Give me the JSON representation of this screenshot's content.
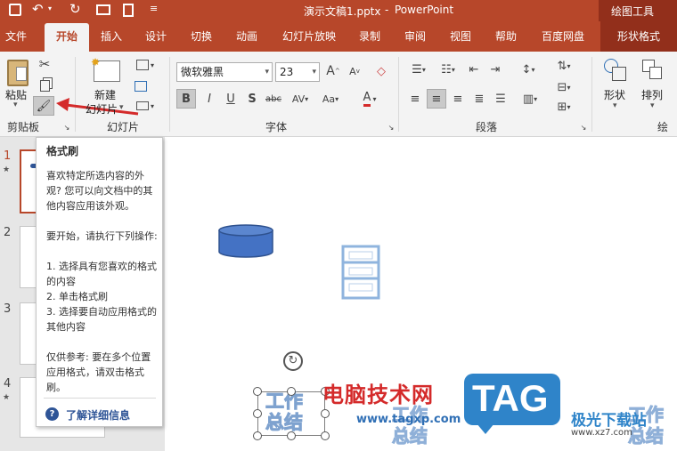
{
  "titlebar": {
    "doc_title": "演示文稿1.pptx",
    "app_name": "PowerPoint",
    "context_tab": "绘图工具",
    "colors": {
      "accent": "#b7472a",
      "accent_dark": "#922f1b"
    }
  },
  "tabs": [
    {
      "label": "文件"
    },
    {
      "label": "开始",
      "active": true
    },
    {
      "label": "插入"
    },
    {
      "label": "设计"
    },
    {
      "label": "切换"
    },
    {
      "label": "动画"
    },
    {
      "label": "幻灯片放映"
    },
    {
      "label": "录制"
    },
    {
      "label": "审阅"
    },
    {
      "label": "视图"
    },
    {
      "label": "帮助"
    },
    {
      "label": "百度网盘"
    },
    {
      "label": "形状格式"
    }
  ],
  "ribbon": {
    "clipboard": {
      "group_label": "剪贴板",
      "paste_label": "粘贴"
    },
    "slides": {
      "group_label": "幻灯片",
      "new_slide_label": "新建",
      "new_slide_label2": "幻灯片"
    },
    "font": {
      "group_label": "字体",
      "font_name": "微软雅黑",
      "font_size": "23"
    },
    "paragraph": {
      "group_label": "段落"
    },
    "drawing": {
      "group_label": "绘图",
      "shapes_label": "形状",
      "arrange_label": "排列"
    }
  },
  "thumbnails": [
    {
      "num": "1",
      "star": "★"
    },
    {
      "num": "2"
    },
    {
      "num": "3"
    },
    {
      "num": "4",
      "star": "★"
    }
  ],
  "tooltip": {
    "title": "格式刷",
    "desc": "喜欢特定所选内容的外观? 您可以向文档中的其他内容应用该外观。",
    "steps_intro": "要开始，请执行下列操作:",
    "step1": "1. 选择具有您喜欢的格式的内容",
    "step2": "2. 单击格式刷",
    "step3": "3. 选择要自动应用格式的其他内容",
    "note": "仅供参考: 要在多个位置应用格式，请双击格式刷。",
    "link": "了解详细信息"
  },
  "slide": {
    "textbox_text": "工作总结",
    "copy_text": "工作总结"
  },
  "watermark": {
    "site_name": "电脑技术网",
    "url": "www.tagxp.com",
    "tag": "TAG",
    "brand": "极光下载站",
    "brand_url": "www.xz7.com"
  }
}
